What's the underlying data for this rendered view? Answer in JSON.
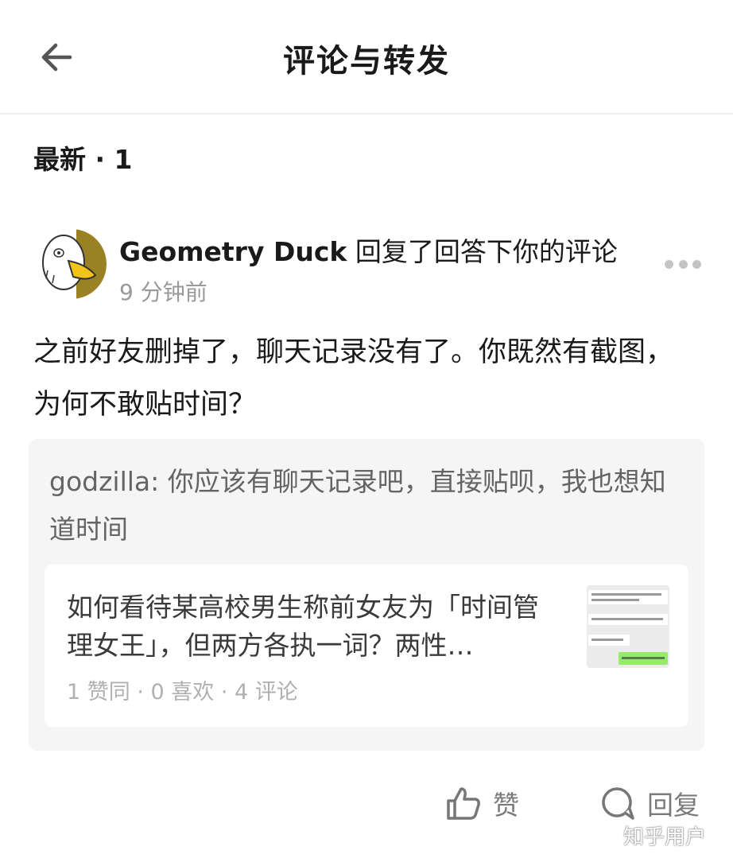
{
  "header": {
    "title": "评论与转发",
    "back_icon": "arrow-left-icon"
  },
  "section": {
    "title": "最新 · 1"
  },
  "comment": {
    "author": "Geometry Duck",
    "action": " 回复了回答下你的评论",
    "time": "9 分钟前",
    "text": "之前好友删掉了，聊天记录没有了。你既然有截图，为何不敢贴时间？",
    "more_icon": "more-dots-icon"
  },
  "quoted": {
    "text": "godzilla: 你应该有聊天记录吧，直接贴呗，我也想知道时间",
    "card": {
      "title": "如何看待某高校男生称前女友为「时间管理女王」，但两方各执一词？两性…",
      "meta": "1 赞同 · 0 喜欢 · 4 评论"
    }
  },
  "actions": {
    "like_label": "赞",
    "reply_label": "回复"
  },
  "watermark": "知乎用户",
  "colors": {
    "text_primary": "#1a1a1a",
    "text_secondary": "#999999",
    "quote_bg": "#f5f5f5",
    "chat_green": "#95ec69"
  }
}
